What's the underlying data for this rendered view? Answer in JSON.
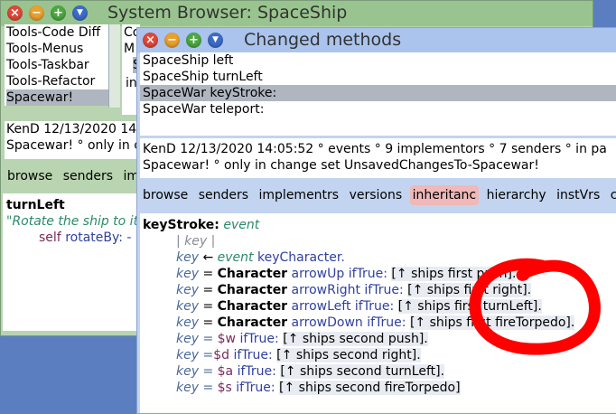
{
  "browser": {
    "title": "System Browser: SpaceShip",
    "categories": [
      "Tools-Code Diff",
      "Tools-Menus",
      "Tools-Taskbar",
      "Tools-Refactor",
      "Spacewar!"
    ],
    "selected_category": "Spacewar!",
    "class_partial": [
      "Co",
      "M",
      "S",
      "in"
    ],
    "info_line1": "KenD 12/13/2020 14",
    "info_line2": "Spacewar! ° only in c",
    "buttons": [
      "browse",
      "senders",
      "im"
    ],
    "method_name": "turnLeft",
    "comment": "\"Rotate the ship to it",
    "body_self": "self",
    "body_msg": "rotateBy: -"
  },
  "changed": {
    "title": "Changed methods",
    "methods": [
      "SpaceShip left",
      "SpaceShip turnLeft",
      "SpaceWar keyStroke:",
      "SpaceWar teleport:"
    ],
    "selected_method": "SpaceWar keyStroke:",
    "info_line1": "KenD 12/13/2020 14:05:52 ° events ° 9 implementors ° 7 senders ° in pa",
    "info_line2": "Spacewar! ° only in change set UnsavedChangesTo-Spacewar!",
    "buttons": [
      "browse",
      "senders",
      "implementrs",
      "versions",
      "inheritanc",
      "hierarchy",
      "instVrs",
      "c"
    ],
    "active_button": "inheritanc",
    "code": {
      "selector": "keyStroke:",
      "arg": "event",
      "temps": "| key |",
      "l3_key": "key",
      "l3_arrow": "←",
      "l3_event": "event",
      "l3_msg": "keyCharacter.",
      "keyword_class": "Character",
      "arrow_lines": [
        {
          "sel": "arrowUp",
          "op": "ifTrue:",
          "block": "[↑ ships first push]."
        },
        {
          "sel": "arrowRight",
          "op": "ifTrue:",
          "block": "[↑ ships first right]."
        },
        {
          "sel": "arrowLeft",
          "op": "ifTrue:",
          "block": "[↑ ships first turnLeft]."
        },
        {
          "sel": "arrowDown",
          "op": "ifTrue:",
          "block": "[↑ ships first fireTorpedo]."
        }
      ],
      "char_lines": [
        {
          "eq": "key = ",
          "ch": "$w",
          "op": "ifTrue:",
          "block": "[↑ ships second push]."
        },
        {
          "eq": "key =",
          "ch": "$d",
          "op": "ifTrue:",
          "block": "[↑ ships second right]."
        },
        {
          "eq": "key = ",
          "ch": "$a",
          "op": "ifTrue:",
          "block": "[↑ ships second turnLeft]."
        },
        {
          "eq": "key = ",
          "ch": "$s",
          "op": "ifTrue:",
          "block": "[↑ ships second fireTorpedo]"
        }
      ]
    }
  },
  "colors": {
    "browser_title_bg": "#99c48f",
    "browser_bg": "#b8d4b0",
    "changed_title_bg": "#aac4ee",
    "changed_bg": "#c2d4f0",
    "annotation": "#ff0000"
  }
}
